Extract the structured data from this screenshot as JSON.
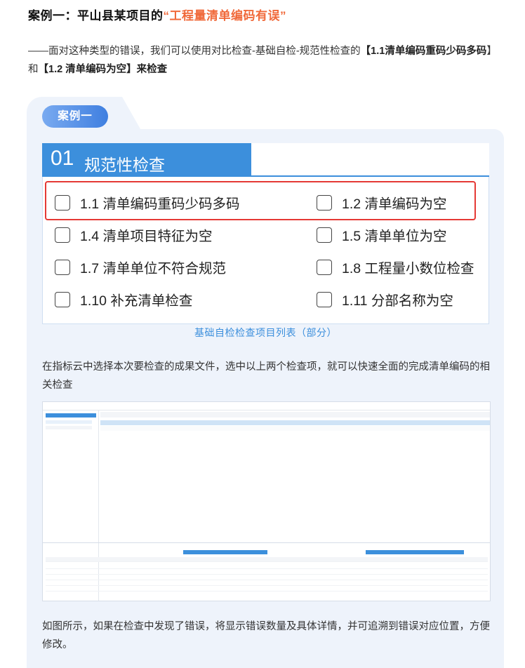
{
  "heading": {
    "prefix": "案例一：平山县某项目的",
    "highlight": "“工程量清单编码有误”"
  },
  "intro": {
    "lead": "——面对这种类型的错误，我们可以使用对比检查-基础自检-规范性检查的",
    "bold1": "【1.1清单编码重码少码多码",
    "mid": "】和",
    "bold2": "【1.2 清单编码为空】来检查"
  },
  "panel": {
    "pill": "案例一",
    "card": {
      "number": "01",
      "title": "规范性检查",
      "items": [
        {
          "label": "1.1 清单编码重码少码多码"
        },
        {
          "label": "1.2 清单编码为空"
        },
        {
          "label": "1.4 清单项目特征为空"
        },
        {
          "label": "1.5 清单单位为空"
        },
        {
          "label": "1.7 清单单位不符合规范"
        },
        {
          "label": "1.8 工程量小数位检查"
        },
        {
          "label": "1.10 补充清单检查"
        },
        {
          "label": "1.11 分部名称为空"
        }
      ],
      "caption": "基础自检检查项目列表（部分）"
    },
    "para1": "在指标云中选择本次要检查的成果文件，选中以上两个检查项，就可以快速全面的完成清单编码的相关检查",
    "para2": "如图所示，如果在检查中发现了错误，将显示错误数量及具体详情，并可追溯到错误对应位置，方便修改。"
  },
  "colors": {
    "accent": "#3c8fdc",
    "highlight": "#f0693a",
    "alert": "#e53935",
    "panel_bg": "#eef3fb"
  }
}
